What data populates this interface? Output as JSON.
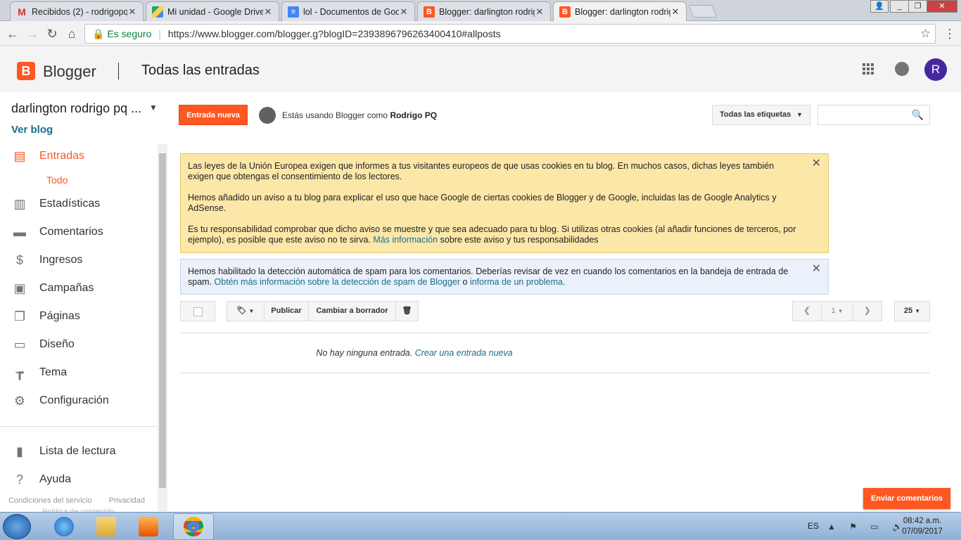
{
  "browser": {
    "tabs": [
      {
        "title": "Recibidos (2) - rodrigopq",
        "icon": "gmail-icon",
        "color": "#d93025"
      },
      {
        "title": "Mi unidad - Google Drive",
        "icon": "drive-icon",
        "color": "#1fa463"
      },
      {
        "title": "lol - Documentos de Goo",
        "icon": "docs-icon",
        "color": "#4285f4"
      },
      {
        "title": "Blogger: darlington rodrig",
        "icon": "blogger-icon",
        "color": "#ff5722"
      },
      {
        "title": "Blogger: darlington rodrig",
        "icon": "blogger-icon",
        "color": "#ff5722",
        "active": true
      }
    ],
    "address": {
      "secure_label": "Es seguro",
      "url": "https://www.blogger.com/blogger.g?blogID=2393896796263400410#allposts"
    }
  },
  "header": {
    "brand": "Blogger",
    "title": "Todas las entradas",
    "avatar_initial": "R",
    "accent": "#ff5722"
  },
  "sidebar": {
    "blog_name": "darlington rodrigo pq ...",
    "view_blog": "Ver blog",
    "items": [
      {
        "label": "Entradas",
        "icon": "posts-icon",
        "active": true
      },
      {
        "label": "Estadísticas",
        "icon": "stats-icon"
      },
      {
        "label": "Comentarios",
        "icon": "comments-icon"
      },
      {
        "label": "Ingresos",
        "icon": "dollar-icon"
      },
      {
        "label": "Campañas",
        "icon": "campaigns-icon"
      },
      {
        "label": "Páginas",
        "icon": "pages-icon"
      },
      {
        "label": "Diseño",
        "icon": "layout-icon"
      },
      {
        "label": "Tema",
        "icon": "paint-roller-icon"
      },
      {
        "label": "Configuración",
        "icon": "gear-icon"
      }
    ],
    "sub_item": "Todo",
    "bottom_items": [
      {
        "label": "Lista de lectura",
        "icon": "bookmark-icon"
      },
      {
        "label": "Ayuda",
        "icon": "help-icon"
      }
    ],
    "footer": {
      "terms": "Condiciones del servicio",
      "privacy": "Privacidad",
      "extra": "Política de contenido"
    }
  },
  "main": {
    "new_post_button": "Entrada nueva",
    "using_prefix": "Estás usando Blogger como",
    "using_user": "Rodrigo PQ",
    "labels_dropdown": "Todas las etiquetas",
    "notice1": {
      "p1": "Las leyes de la Unión Europea exigen que informes a tus visitantes europeos de que usas cookies en tu blog. En muchos casos, dichas leyes también exigen que obtengas el consentimiento de los lectores.",
      "p2": "Hemos añadido un aviso a tu blog para explicar el uso que hace Google de ciertas cookies de Blogger y de Google, incluidas las de Google Analytics y AdSense.",
      "p3_a": "Es tu responsabilidad comprobar que dicho aviso se muestre y que sea adecuado para tu blog. Si utilizas otras cookies (al añadir funciones de terceros, por ejemplo), es posible que este aviso no te sirva.",
      "p3_link": "Más información",
      "p3_b": "sobre este aviso y tus responsabilidades"
    },
    "notice2": {
      "text": "Hemos habilitado la detección automática de spam para los comentarios. Deberías revisar de vez en cuando los comentarios en la bandeja de entrada de spam.",
      "link1": "Obtén más información sobre la detección de spam de Blogger",
      "middle": "o",
      "link2": "informa de un problema."
    },
    "toolbar": {
      "publish": "Publicar",
      "revert_draft": "Cambiar a borrador",
      "page": "1",
      "per_page": "25"
    },
    "empty_text": "No hay ninguna entrada.",
    "empty_link": "Crear una entrada nueva",
    "feedback": "Enviar comentarios"
  },
  "taskbar": {
    "lang": "ES",
    "time": "08:42 a.m.",
    "date": "07/09/2017"
  }
}
